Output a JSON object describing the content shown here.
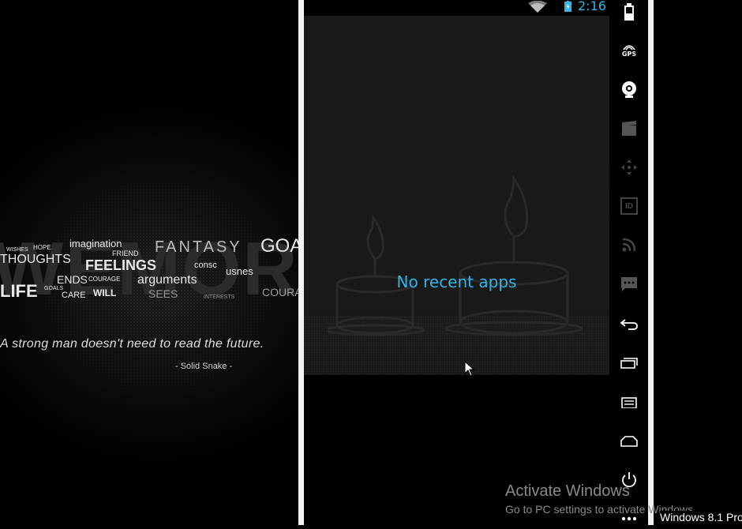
{
  "wallpaper": {
    "big_word": "WEMORY",
    "words": [
      {
        "text": "imagination",
        "size": 13
      },
      {
        "text": "FANTASY",
        "size": 20
      },
      {
        "text": "GOA",
        "size": 24
      },
      {
        "text": "THOUGHTS",
        "size": 16
      },
      {
        "text": "FRIEND",
        "size": 9
      },
      {
        "text": "FEELINGS",
        "size": 18
      },
      {
        "text": "consc",
        "size": 11
      },
      {
        "text": "usnes",
        "size": 13
      },
      {
        "text": "HOPE",
        "size": 8
      },
      {
        "text": "WISHES",
        "size": 7
      },
      {
        "text": "ENDS",
        "size": 14
      },
      {
        "text": "COURAGE",
        "size": 8
      },
      {
        "text": "arguments",
        "size": 16
      },
      {
        "text": "CARE",
        "size": 11
      },
      {
        "text": "WILL",
        "size": 12
      },
      {
        "text": "SEES",
        "size": 14
      },
      {
        "text": "INTERESTS",
        "size": 7
      },
      {
        "text": "COURA",
        "size": 14
      },
      {
        "text": "LIFE",
        "size": 22
      },
      {
        "text": "GOALS",
        "size": 7
      }
    ],
    "quote": "A strong man doesn't need to read the future.",
    "quote_author": "- Solid Snake -"
  },
  "statusbar": {
    "time": "2:16",
    "icons": [
      "wifi-icon",
      "battery-charging-icon"
    ]
  },
  "recents": {
    "empty_text": "No recent apps"
  },
  "toolbar": {
    "buttons": [
      {
        "name": "battery-icon",
        "interactable": true
      },
      {
        "name": "gps-icon",
        "label": "GPS",
        "interactable": true
      },
      {
        "name": "webcam-icon",
        "interactable": true
      },
      {
        "name": "screencast-icon",
        "interactable": true
      },
      {
        "name": "move-icon",
        "interactable": true
      },
      {
        "name": "identifiers-icon",
        "label": "ID",
        "interactable": true
      },
      {
        "name": "rss-icon",
        "interactable": true
      },
      {
        "name": "sms-icon",
        "interactable": true
      },
      {
        "name": "back-icon",
        "interactable": true
      },
      {
        "name": "recent-apps-icon",
        "interactable": true
      },
      {
        "name": "menu-icon",
        "interactable": true
      },
      {
        "name": "home-icon",
        "interactable": true
      },
      {
        "name": "power-icon",
        "interactable": true
      },
      {
        "name": "more-icon",
        "interactable": true
      }
    ]
  },
  "watermark": {
    "title": "Activate Windows",
    "subtitle": "Go to PC settings to activate Windows.",
    "edition": "Windows 8.1 Pro"
  },
  "colors": {
    "accent": "#33b5e5",
    "frame": "#f2f2f2",
    "background": "#000000"
  }
}
